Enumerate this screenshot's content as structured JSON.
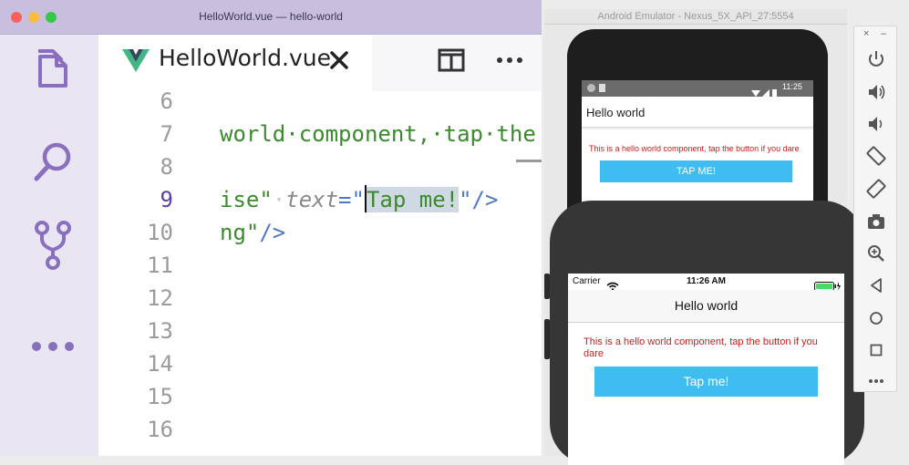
{
  "vscode": {
    "window_title": "HelloWorld.vue — hello-world",
    "tab_title": "HelloWorld.vue",
    "activity_icons": [
      "files-icon",
      "search-icon",
      "source-control-icon",
      "more-icon"
    ],
    "line_numbers": [
      "6",
      "7",
      "8",
      "9",
      "10",
      "11",
      "12",
      "13",
      "14",
      "15",
      "16"
    ],
    "active_line": "9",
    "code": {
      "line7": {
        "text": "world·component,·tap·the"
      },
      "line9": {
        "part1": "ise\"",
        "part2": "text",
        "part3": "=\"",
        "selected": "Tap me!",
        "part4": "\"/>"
      },
      "line10": {
        "part1": "ng\"",
        "part2": "/>"
      }
    }
  },
  "android": {
    "window_title": "Android Emulator - Nexus_5X_API_27:5554",
    "status_time": "11:25",
    "app_title": "Hello world",
    "message": "This is a hello world component, tap the button if you dare",
    "button_label": "TAP ME!"
  },
  "ios": {
    "carrier": "Carrier",
    "status_time": "11:26 AM",
    "nav_title": "Hello world",
    "message": "This is a hello world component, tap the button if you dare",
    "button_label": "Tap me!"
  },
  "emulator_toolbar": {
    "close": "×",
    "minimize": "–",
    "icons": [
      "power-icon",
      "volume-up-icon",
      "volume-down-icon",
      "rotate-left-icon",
      "rotate-right-icon",
      "camera-icon",
      "zoom-icon",
      "back-icon",
      "home-icon",
      "overview-icon",
      "more-icon"
    ]
  },
  "colors": {
    "titlebar": "#c8bfdf",
    "activity_bar": "#e9e5f2",
    "activity_icon": "#8b6fbf",
    "vue_green": "#41b883",
    "button_blue": "#3fbdf0",
    "message_red": "#c81e1e"
  }
}
